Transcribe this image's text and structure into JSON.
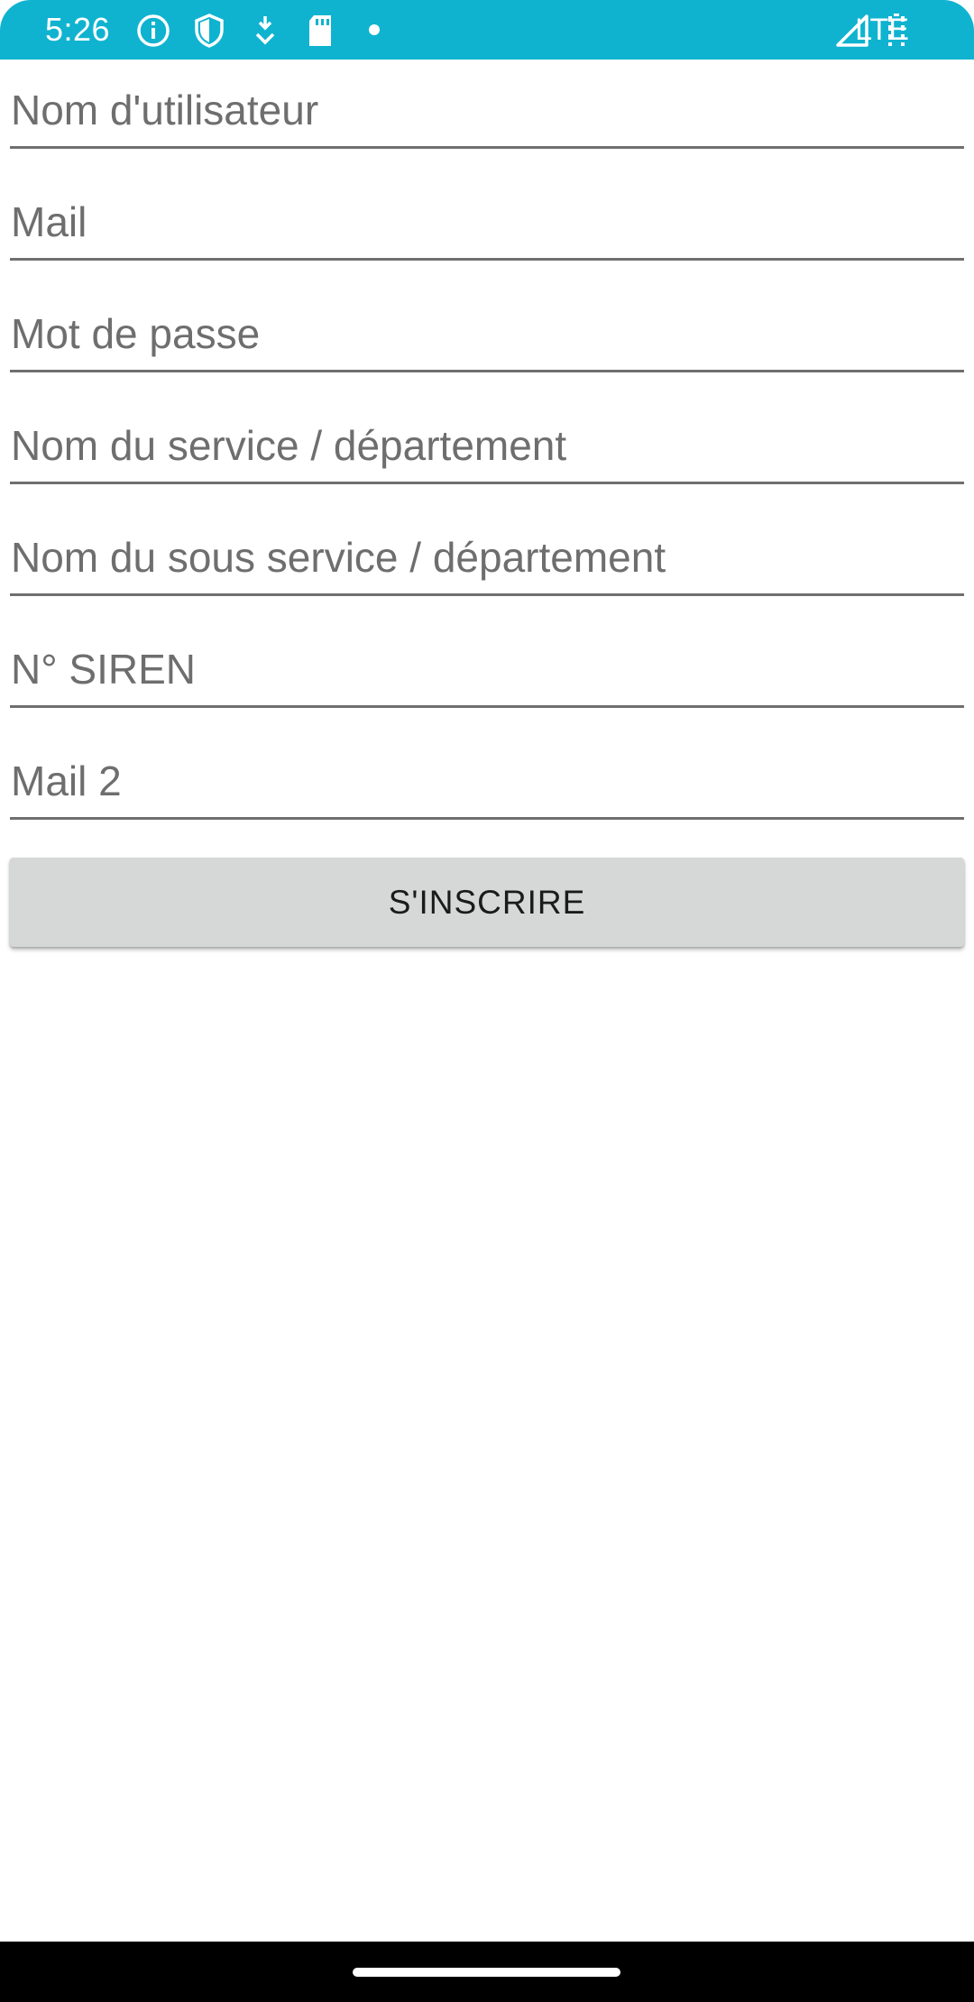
{
  "status_bar": {
    "time": "5:26",
    "network": "LTE",
    "background_color": "#0fb3d0",
    "icons": [
      "info-icon",
      "shield-icon",
      "download-icon",
      "sd-card-icon",
      "dot-icon",
      "signal-icon",
      "battery-icon"
    ]
  },
  "form": {
    "fields": [
      {
        "placeholder": "Nom d'utilisateur",
        "value": ""
      },
      {
        "placeholder": "Mail",
        "value": ""
      },
      {
        "placeholder": "Mot de passe",
        "value": ""
      },
      {
        "placeholder": "Nom du service / département",
        "value": ""
      },
      {
        "placeholder": "Nom du sous service / département",
        "value": ""
      },
      {
        "placeholder": "N° SIREN",
        "value": ""
      },
      {
        "placeholder": "Mail 2",
        "value": ""
      }
    ],
    "submit_label": "S'INSCRIRE"
  }
}
